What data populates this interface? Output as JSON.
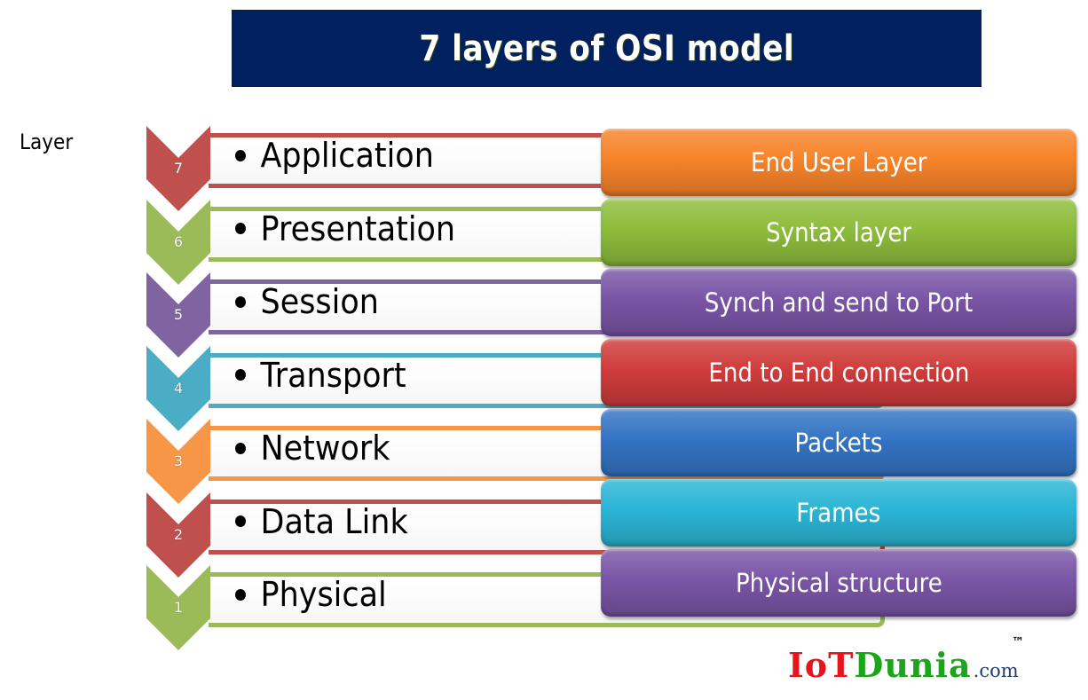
{
  "title": "7 layers of OSI model",
  "layer_heading": "Layer",
  "layers": [
    {
      "number": "7",
      "name": "Application",
      "description": "End User Layer",
      "chevron_color": "#c0504d",
      "box_color": "#f7842a"
    },
    {
      "number": "6",
      "name": "Presentation",
      "description": "Syntax layer",
      "chevron_color": "#9bbb59",
      "box_color": "#8ebd3c"
    },
    {
      "number": "5",
      "name": "Session",
      "description": "Synch and send to Port",
      "chevron_color": "#8064a2",
      "box_color": "#7a55a6"
    },
    {
      "number": "4",
      "name": "Transport",
      "description": "End to End connection",
      "chevron_color": "#4bacc6",
      "box_color": "#d03c3c"
    },
    {
      "number": "3",
      "name": "Network",
      "description": "Packets",
      "chevron_color": "#f79646",
      "box_color": "#3474c4"
    },
    {
      "number": "2",
      "name": "Data Link",
      "description": "Frames",
      "chevron_color": "#c0504d",
      "box_color": "#2bb6d6"
    },
    {
      "number": "1",
      "name": "Physical",
      "description": "Physical structure",
      "chevron_color": "#9bbb59",
      "box_color": "#7a55a6"
    }
  ],
  "logo": {
    "part1": "IoT",
    "part2": "Dunia",
    "suffix": ".com",
    "trademark": "™"
  },
  "colors": {
    "title_banner": "#002060",
    "logo_red": "#e8141b",
    "logo_green": "#1aa51a"
  }
}
